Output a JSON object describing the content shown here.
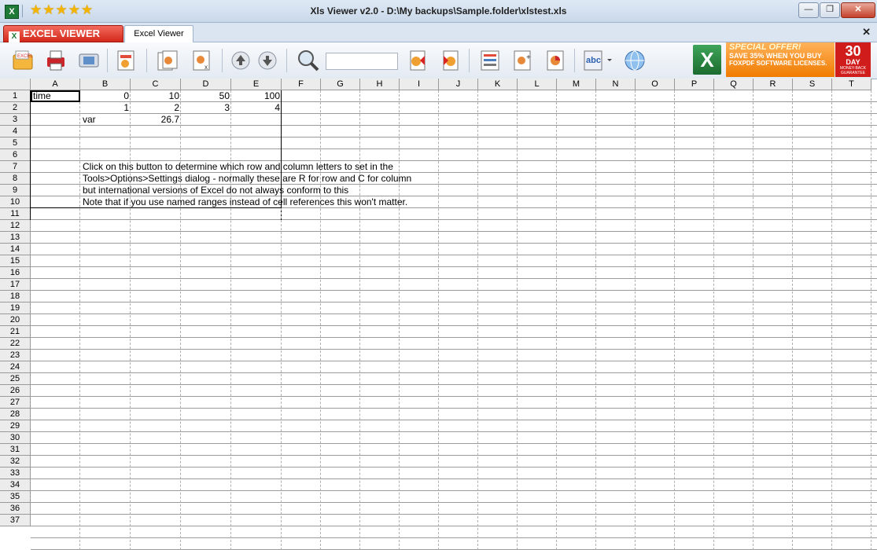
{
  "window": {
    "title": "Xls Viewer v2.0 - D:\\My backups\\Sample.folder\\xlstest.xls",
    "app_icon": "X",
    "rating_stars": "★★★★★",
    "minimize": "—",
    "maximize": "❐",
    "close": "✕"
  },
  "tabs": {
    "logo_label": "EXCEL VIEWER",
    "logo_icon": "X",
    "doc_tab": "Excel Viewer",
    "close": "✕"
  },
  "ad": {
    "offer_title": "SPECIAL OFFER!",
    "offer_line2": "SAVE 35% WHEN YOU BUY",
    "offer_line3": "FOXPDF SOFTWARE LICENSES.",
    "days_number": "30",
    "days_label": "DAY",
    "guarantee": "MONEY-BACK GUARANTEE",
    "excel_icon": "X"
  },
  "sheet": {
    "columns": [
      "A",
      "B",
      "C",
      "D",
      "E",
      "F",
      "G",
      "H",
      "I",
      "J",
      "K",
      "L",
      "M",
      "N",
      "O",
      "P",
      "Q",
      "R",
      "S",
      "T"
    ],
    "rows": [
      "1",
      "2",
      "3",
      "4",
      "5",
      "6",
      "7",
      "8",
      "9",
      "10",
      "11",
      "12",
      "13",
      "14",
      "15",
      "16",
      "17",
      "18",
      "19",
      "20",
      "21",
      "22",
      "23",
      "24",
      "25",
      "26",
      "27",
      "28",
      "29",
      "30",
      "31",
      "32",
      "33",
      "34",
      "35",
      "36",
      "37"
    ],
    "cells": {
      "A1": "time",
      "B1": "0",
      "C1": "10",
      "D1": "50",
      "E1": "100",
      "B2": "1",
      "C2": "2",
      "D2": "3",
      "E2": "4",
      "B3": "var",
      "C3": "26.7",
      "B7": "Click on this button to determine which row and column letters to set in the",
      "B8": "Tools>Options>Settings dialog - normally these are R for row and C for column",
      "B9": "but international versions of Excel do not always conform to this",
      "B10": "Note that if you use named ranges instead of cell references this won't matter."
    }
  }
}
